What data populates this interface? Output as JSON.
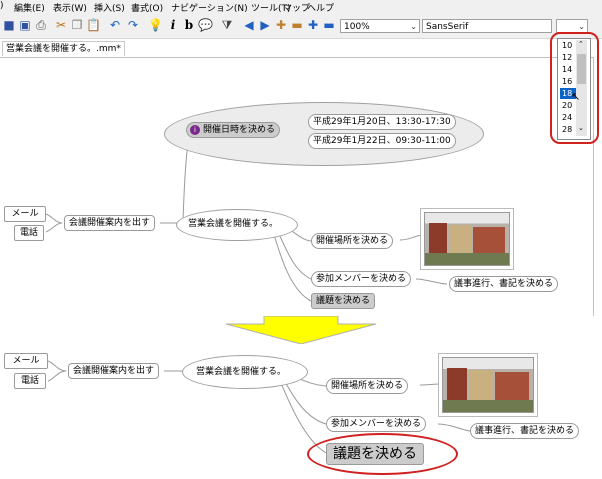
{
  "menubar": {
    "items": [
      ")",
      "編集(E)",
      "表示(W)",
      "挿入(S)",
      "書式(O)",
      "ナビゲーション(N)",
      "ツール(T)",
      "マップ",
      "ヘルプ"
    ]
  },
  "toolbar": {
    "zoom": "100%",
    "font": "SansSerif",
    "size": "",
    "italic_label": "i",
    "bold_label": "b"
  },
  "tab": {
    "title": "営業会議を開催する。.mm*"
  },
  "size_dropdown": {
    "options": [
      "10",
      "12",
      "14",
      "16",
      "18",
      "20",
      "24",
      "28"
    ],
    "selected": "18"
  },
  "before_map": {
    "root": "営業会議を開催する。",
    "decide_datetime": "開催日時を決める",
    "date1": "平成29年1月20日、13:30-17:30",
    "date2": "平成29年1月22日、09:30-11:00",
    "send_notice": "会議開催案内を出す",
    "mail": "メール",
    "phone": "電話",
    "decide_place": "開催場所を決める",
    "decide_members": "参加メンバーを決める",
    "minutes": "議事進行、書記を決める",
    "decide_agenda": "議題を決める"
  },
  "after_map": {
    "root": "営業会議を開催する。",
    "send_notice": "会議開催案内を出す",
    "mail": "メール",
    "phone": "電話",
    "decide_place": "開催場所を決める",
    "decide_members": "参加メンバーを決める",
    "minutes": "議事進行、書記を決める",
    "decide_agenda": "議題を決める"
  },
  "colors": {
    "highlight": "#d02020",
    "arrow": "#ffff00",
    "selected": "#0a64c8"
  }
}
